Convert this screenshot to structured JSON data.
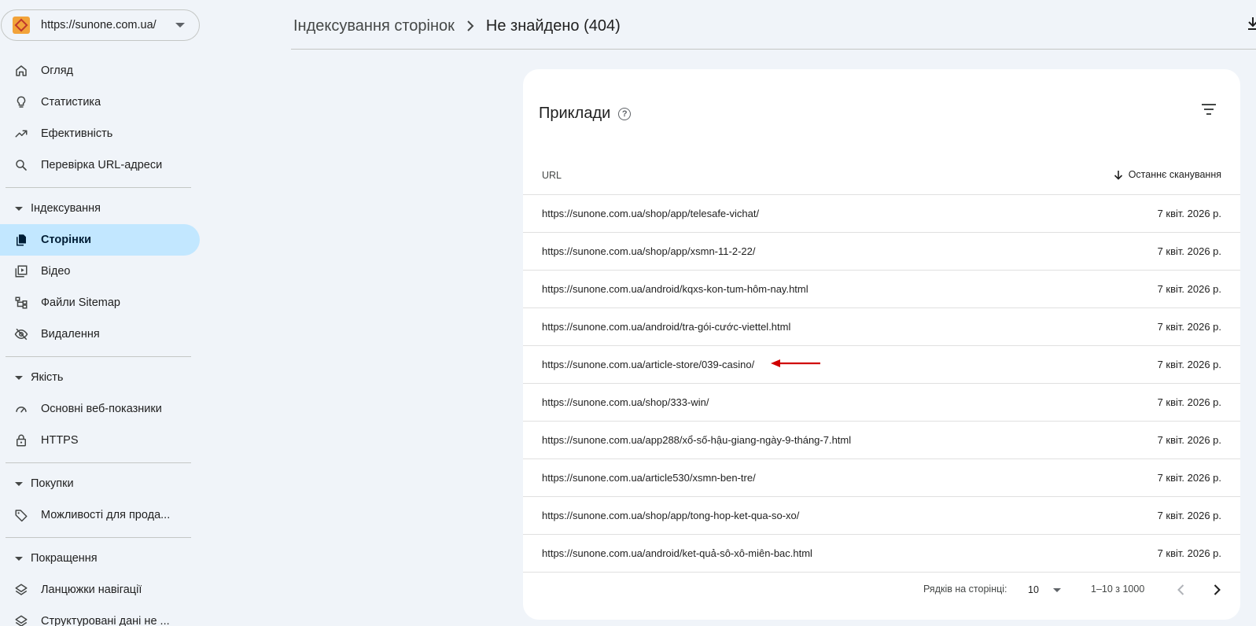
{
  "property": {
    "url": "https://sunone.com.ua/"
  },
  "sidebar": {
    "top_items": [
      {
        "label": "Огляд",
        "icon": "home-icon"
      },
      {
        "label": "Статистика",
        "icon": "lightbulb-icon"
      },
      {
        "label": "Ефективність",
        "icon": "trending-up-icon"
      },
      {
        "label": "Перевірка URL-адреси",
        "icon": "search-icon"
      }
    ],
    "sections": [
      {
        "title": "Індексування",
        "items": [
          {
            "label": "Сторінки",
            "icon": "pages-icon",
            "active": true
          },
          {
            "label": "Відео",
            "icon": "video-icon"
          },
          {
            "label": "Файли Sitemap",
            "icon": "sitemap-icon"
          },
          {
            "label": "Видалення",
            "icon": "visibility-off-icon"
          }
        ]
      },
      {
        "title": "Якість",
        "items": [
          {
            "label": "Основні веб-показники",
            "icon": "speed-icon"
          },
          {
            "label": "HTTPS",
            "icon": "lock-icon"
          }
        ]
      },
      {
        "title": "Покупки",
        "items": [
          {
            "label": "Можливості для прода...",
            "icon": "tag-icon"
          }
        ]
      },
      {
        "title": "Покращення",
        "items": [
          {
            "label": "Ланцюжки навігації",
            "icon": "layers-icon"
          },
          {
            "label": "Структуровані дані не ...",
            "icon": "layers-icon"
          }
        ]
      }
    ]
  },
  "header": {
    "breadcrumb_parent": "Індексування сторінок",
    "breadcrumb_current": "Не знайдено (404)"
  },
  "card": {
    "title": "Приклади",
    "help_glyph": "?",
    "columns": {
      "url": "URL",
      "date": "Останнє сканування"
    },
    "rows": [
      {
        "url": "https://sunone.com.ua/shop/app/telesafe-vichat/",
        "date": "7 квіт. 2026 р."
      },
      {
        "url": "https://sunone.com.ua/shop/app/xsmn-11-2-22/",
        "date": "7 квіт. 2026 р."
      },
      {
        "url": "https://sunone.com.ua/android/kqxs-kon-tum-hôm-nay.html",
        "date": "7 квіт. 2026 р."
      },
      {
        "url": "https://sunone.com.ua/android/tra-gói-cước-viettel.html",
        "date": "7 квіт. 2026 р."
      },
      {
        "url": "https://sunone.com.ua/article-store/039-casino/",
        "date": "7 квіт. 2026 р.",
        "annotated": true
      },
      {
        "url": "https://sunone.com.ua/shop/333-win/",
        "date": "7 квіт. 2026 р."
      },
      {
        "url": "https://sunone.com.ua/app288/xổ-số-hậu-giang-ngày-9-tháng-7.html",
        "date": "7 квіт. 2026 р."
      },
      {
        "url": "https://sunone.com.ua/article530/xsmn-ben-tre/",
        "date": "7 квіт. 2026 р."
      },
      {
        "url": "https://sunone.com.ua/shop/app/tong-hop-ket-qua-so-xo/",
        "date": "7 квіт. 2026 р."
      },
      {
        "url": "https://sunone.com.ua/android/ket-quả-sô-xô-miên-bac.html",
        "date": "7 квіт. 2026 р."
      }
    ],
    "pager": {
      "rows_label": "Рядків на сторінці:",
      "rows_value": "10",
      "range": "1–10 з 1000"
    }
  },
  "colors": {
    "active_bg": "#c2e7ff",
    "page_bg": "#f0f4f9",
    "annotation": "#d00000"
  }
}
